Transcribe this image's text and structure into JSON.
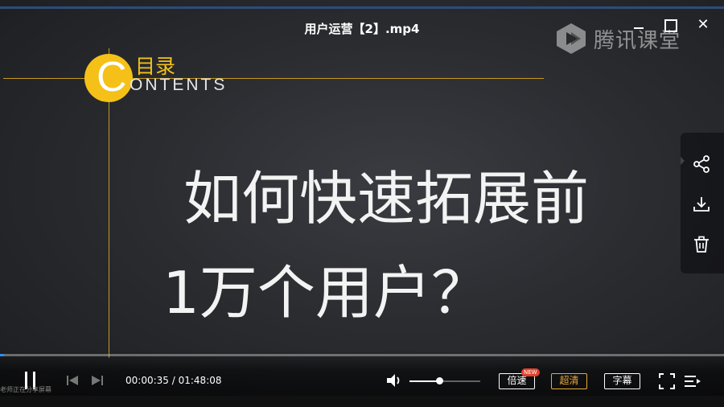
{
  "window": {
    "title": "用户运营【2】.mp4",
    "close_glyph": "✕"
  },
  "brand": {
    "text": "腾讯课堂",
    "icon": "tencent-classroom-logo-icon"
  },
  "slide": {
    "toc_letter": "C",
    "toc_title_cn": "目录",
    "toc_title_en": "ONTENTS",
    "headline_line1": "如何快速拓展前",
    "headline_line2": "1万个用户？",
    "accent_color": "#f5c118"
  },
  "side_panel": {
    "items": [
      {
        "icon": "share-icon"
      },
      {
        "icon": "download-icon"
      },
      {
        "icon": "delete-icon"
      }
    ]
  },
  "player": {
    "progress_fraction": 0.0054,
    "current_time": "00:00:35",
    "separator": "/",
    "duration": "01:48:08",
    "volume_fraction": 0.42,
    "speed_label": "倍速",
    "speed_badge": "NEW",
    "quality_label": "超清",
    "subtitle_label": "字幕",
    "footer_note": "老师正在分享屏幕",
    "progress_color": "#2e8ef2",
    "quality_color": "#e9a83a"
  }
}
